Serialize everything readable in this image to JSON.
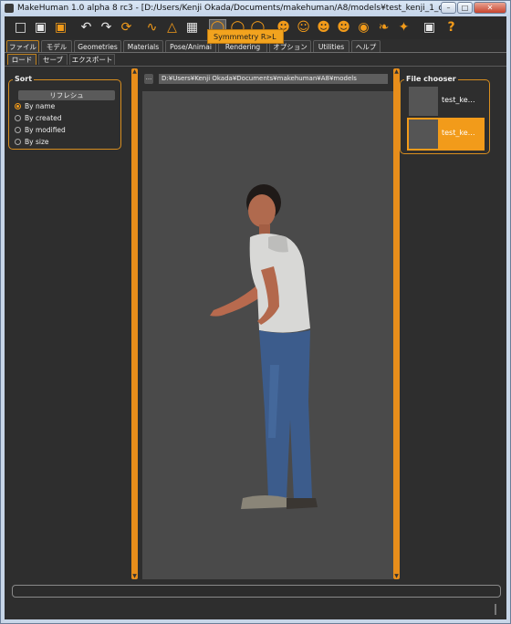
{
  "window": {
    "title": "MakeHuman 1.0 alpha 8 rc3 - [D:/Users/Kenji Okada/Documents/makehuman/A8/models¥test_kenji_1_old.mh...",
    "minimize": "–",
    "maximize": "□",
    "close": "✕"
  },
  "toolbar": {
    "tooltip": "Symmmetry R>L",
    "icons": [
      "new-file",
      "save-file",
      "export-file",
      "undo",
      "redo",
      "reset",
      "smooth",
      "wireframe",
      "background",
      "symmetry-r-l",
      "symmetry-l-r",
      "symmetry",
      "front-view",
      "back-view",
      "left-view",
      "right-view",
      "top-view",
      "bottom-view",
      "global-camera",
      "screenshot",
      "help"
    ]
  },
  "tabs": [
    "ファイル",
    "モデル",
    "Geometries",
    "Materials",
    "Pose/Animai",
    "Rendering",
    "オプション",
    "Utilities",
    "ヘルプ"
  ],
  "subtabs": [
    "ロード",
    "セーブ",
    "エクスポート"
  ],
  "sort": {
    "title": "Sort",
    "refresh_label": "リフレシュ",
    "options": [
      "By name",
      "By created",
      "By modified",
      "By size"
    ],
    "selected": "By name"
  },
  "path": {
    "button_label": "...",
    "value": "D:¥Users¥Kenji Okada¥Documents¥makehuman¥A8¥models"
  },
  "file_chooser": {
    "title": "File chooser",
    "files": [
      {
        "name": "test_ke…",
        "selected": false
      },
      {
        "name": "test_ke…",
        "selected": true
      }
    ]
  },
  "colors": {
    "accent": "#f29b1a",
    "panel": "#2e2e2e",
    "viewport": "#4a4a4a"
  }
}
